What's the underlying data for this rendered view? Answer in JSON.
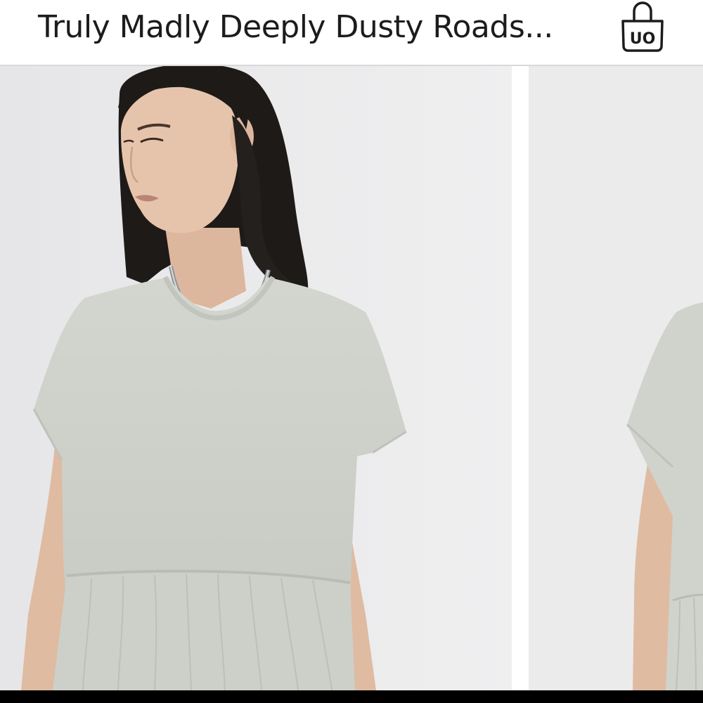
{
  "header": {
    "product_title": "Truly Madly Deeply Dusty Roads...",
    "bag_icon": "shopping-bag-icon",
    "bag_badge_text": "UO"
  },
  "gallery": {
    "images": [
      {
        "name": "product-photo-front"
      },
      {
        "name": "product-photo-side"
      }
    ]
  },
  "colors": {
    "background": "#ffffff",
    "photo_backdrop": "#e9e9ea",
    "garment": "#cfd2cb",
    "hair": "#1e1a18",
    "skin": "#e2c0a8",
    "text": "#1c1c1c"
  }
}
